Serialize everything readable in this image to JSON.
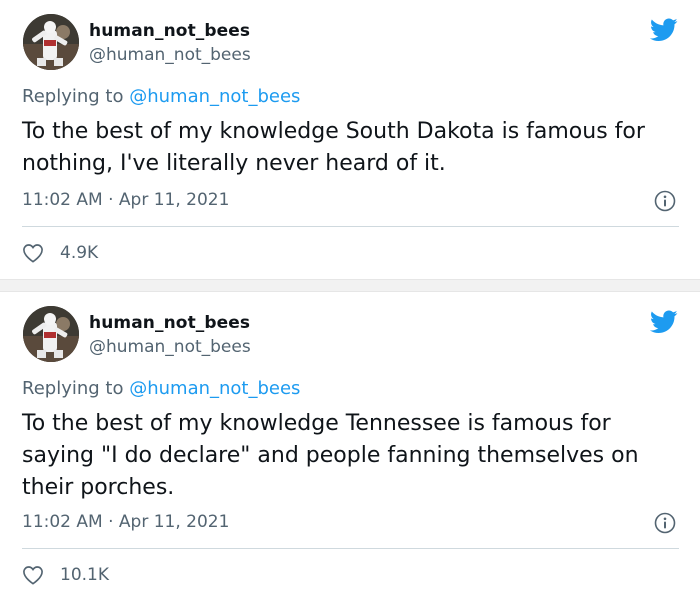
{
  "tweets": [
    {
      "display_name": "human_not_bees",
      "handle": "@human_not_bees",
      "replying_prefix": "Replying to",
      "replying_to": "@human_not_bees",
      "text": "To the best of my knowledge South Dakota is famous for nothing, I've literally never heard of it.",
      "time": "11:02 AM",
      "separator": "·",
      "date": "Apr 11, 2021",
      "likes": "4.9K"
    },
    {
      "display_name": "human_not_bees",
      "handle": "@human_not_bees",
      "replying_prefix": "Replying to",
      "replying_to": "@human_not_bees",
      "text": "To the best of my knowledge Tennessee is famous for saying \"I do declare\" and people fanning themselves on their porches.",
      "time": "11:02 AM",
      "separator": "·",
      "date": "Apr 11, 2021",
      "likes": "10.1K"
    }
  ],
  "icons": {
    "brand": "twitter-bird-icon",
    "info": "info-icon",
    "like": "heart-icon"
  },
  "colors": {
    "brand_blue": "#1d9bf0",
    "secondary_text": "#536471",
    "primary_text": "#0f1419",
    "divider": "#cfd9de"
  }
}
